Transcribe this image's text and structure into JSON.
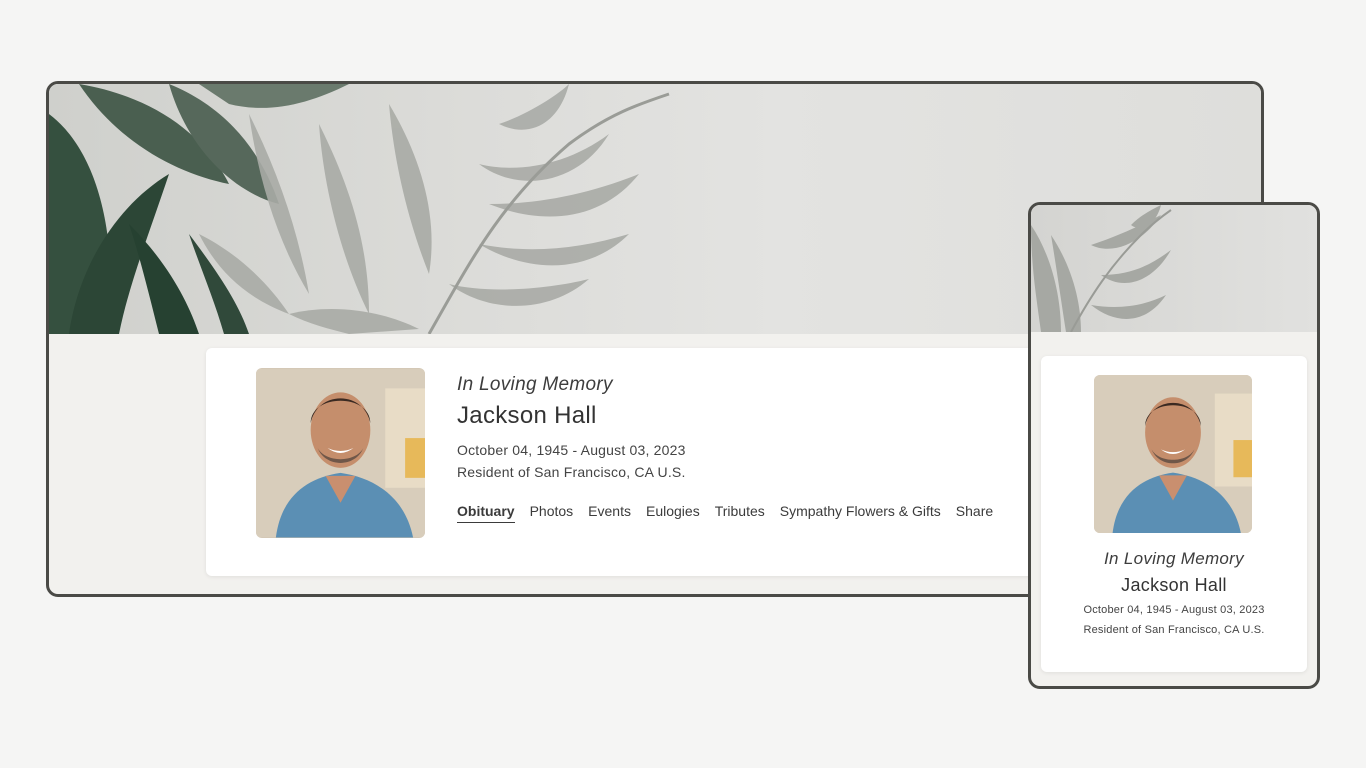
{
  "memorial": {
    "heading": "In Loving Memory",
    "name": "Jackson Hall",
    "dates": "October 04, 1945 - August 03, 2023",
    "residence": "Resident of San Francisco, CA U.S."
  },
  "nav": {
    "items": [
      "Obituary",
      "Photos",
      "Events",
      "Eulogies",
      "Tributes",
      "Sympathy Flowers & Gifts",
      "Share"
    ],
    "active": "Obituary"
  },
  "colors": {
    "frame_border": "#4a4a46",
    "page_background": "#f5f5f4",
    "card_background": "#ffffff",
    "banner_background": "#dededb",
    "leaf_dark": "#2f4a3a",
    "leaf_light": "#a9aba6"
  }
}
